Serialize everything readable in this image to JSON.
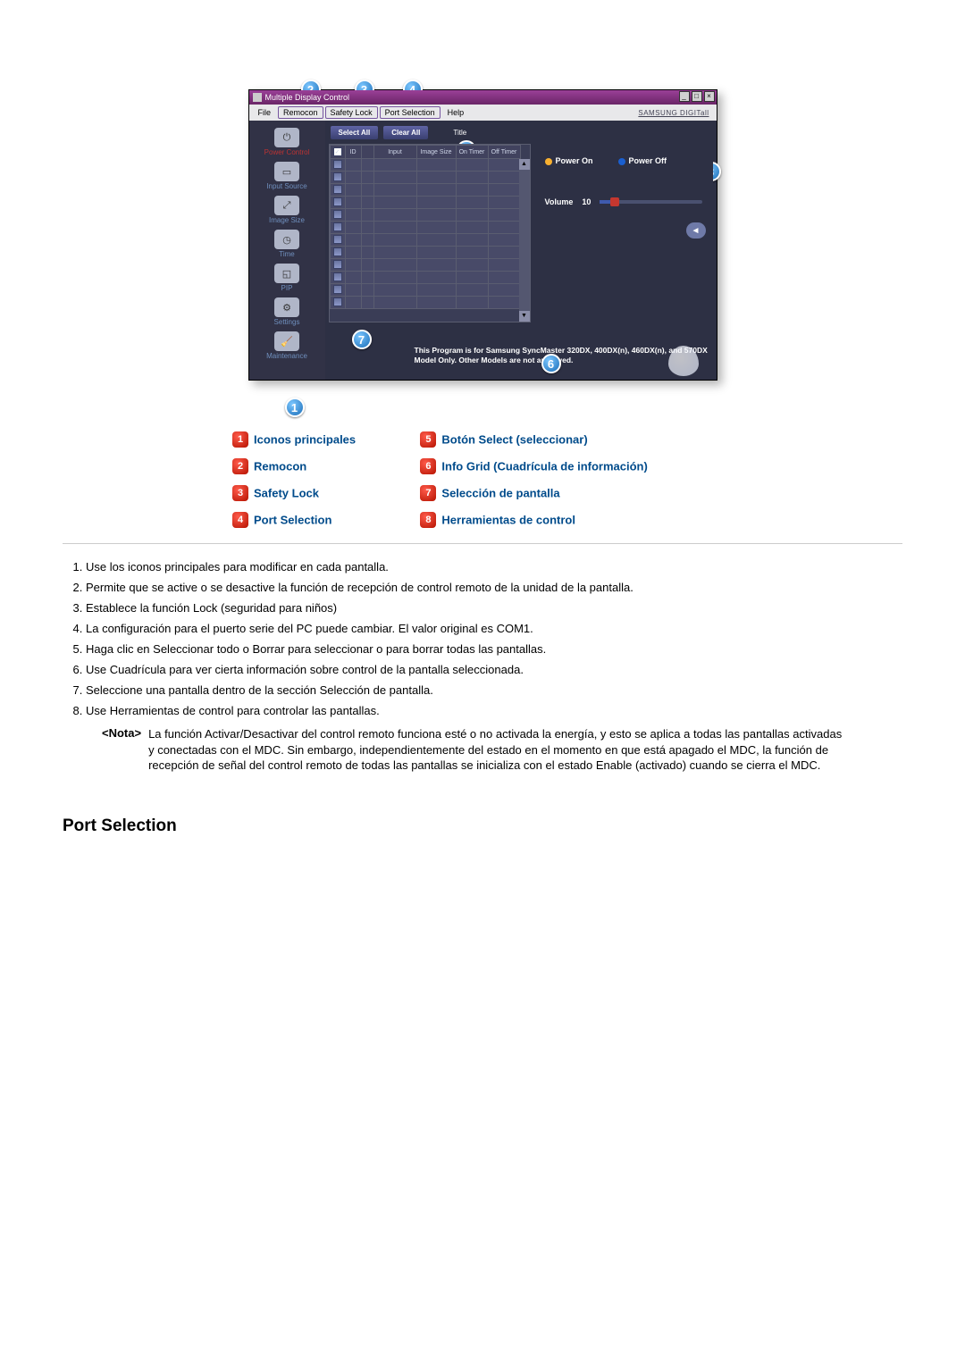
{
  "app": {
    "title": "Multiple Display Control",
    "menu": {
      "file": "File",
      "remocon": "Remocon",
      "safetyLock": "Safety Lock",
      "portSelection": "Port Selection",
      "help": "Help"
    },
    "brand": "SAMSUNG DIGITall"
  },
  "toolbar": {
    "selectAll": "Select All",
    "clearAll": "Clear All",
    "titleSuffix": "Title"
  },
  "sidebar": {
    "items": [
      {
        "label": "Power Control"
      },
      {
        "label": "Input Source"
      },
      {
        "label": "Image Size"
      },
      {
        "label": "Time"
      },
      {
        "label": "PIP"
      },
      {
        "label": "Settings"
      },
      {
        "label": "Maintenance"
      }
    ]
  },
  "grid": {
    "headers": {
      "chk": "",
      "id": "ID",
      "status": "",
      "input": "Input",
      "imageSize": "Image Size",
      "onTimer": "On Timer",
      "offTimer": "Off Timer"
    }
  },
  "panel": {
    "powerOn": "Power On",
    "powerOff": "Power Off",
    "volumeLabel": "Volume",
    "volumeValue": "10"
  },
  "footer": {
    "text": "This Program is for Samsung SyncMaster 320DX, 400DX(n), 460DX(n), and 570DX  Model Only. Other Models are not approved."
  },
  "legend": {
    "l1": "Iconos principales",
    "l2": "Remocon",
    "l3": "Safety Lock",
    "l4": "Port Selection",
    "l5": "Botón Select (seleccionar)",
    "l6": "Info Grid (Cuadrícula de información)",
    "l7": "Selección de pantalla",
    "l8": "Herramientas de control"
  },
  "notes": {
    "n1": "Use los iconos principales para modificar en cada pantalla.",
    "n2": "Permite que se active o se desactive la función de recepción de control remoto de la unidad de la pantalla.",
    "n3": "Establece la función Lock (seguridad para niños)",
    "n4": "La configuración para el puerto serie del PC puede cambiar. El valor original es COM1.",
    "n5": "Haga clic en Seleccionar todo o Borrar para seleccionar o para borrar todas las pantallas.",
    "n6": "Use Cuadrícula para ver cierta información sobre control de la pantalla seleccionada.",
    "n7": "Seleccione una pantalla dentro de la sección Selección de pantalla.",
    "n8": "Use Herramientas de control para controlar las pantallas.",
    "notaLabel": "<Nota>",
    "nota": "La función Activar/Desactivar del control remoto funciona esté o no activada la energía, y esto se aplica a todas las pantallas activadas y conectadas con el MDC. Sin embargo, independientemente del estado en el momento en que está apagado el MDC, la función de recepción de señal del control remoto de todas las pantallas se inicializa con el estado Enable (activado) cuando se cierra el MDC."
  },
  "sectionTitle": "Port Selection"
}
